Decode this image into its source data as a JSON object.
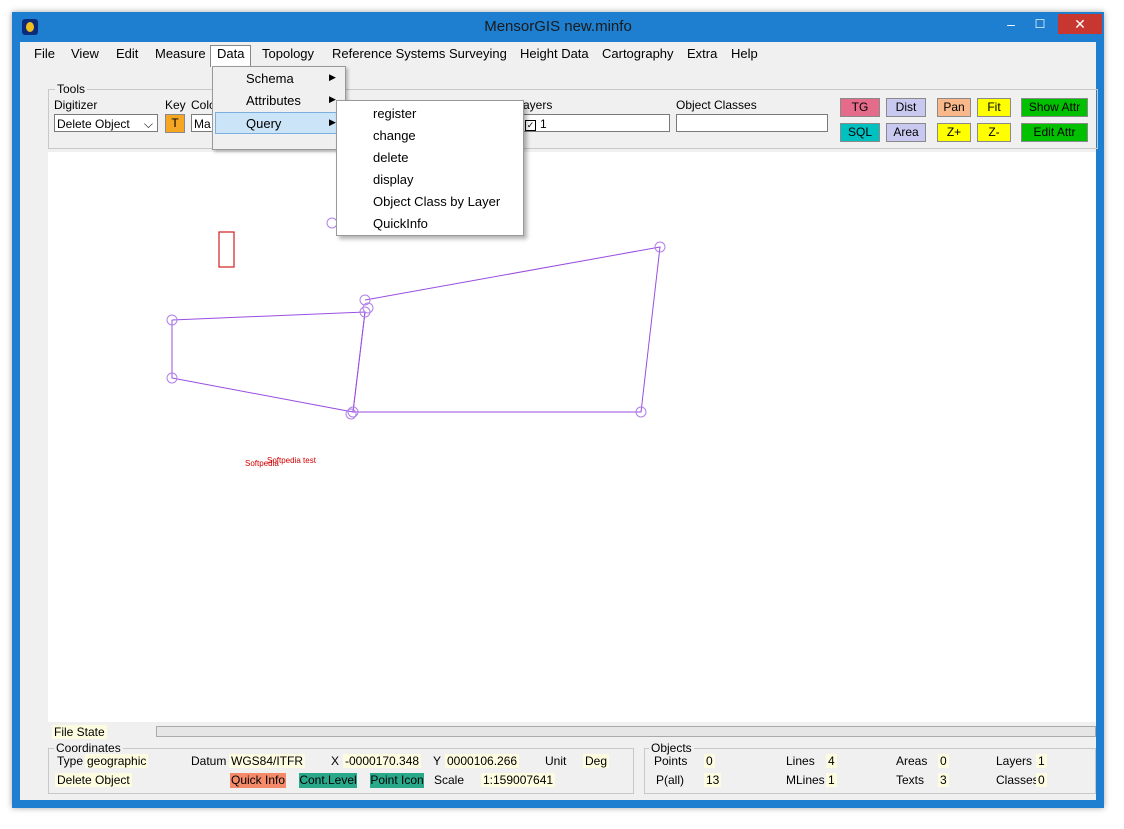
{
  "window": {
    "title": "MensorGIS new.minfo",
    "min": "–",
    "max": "☐",
    "close": "✕"
  },
  "menu": [
    "File",
    "View",
    "Edit",
    "Measure",
    "Data",
    "Topology",
    "Reference Systems",
    "Surveying",
    "Height Data",
    "Cartography",
    "Extra",
    "Help"
  ],
  "data_menu": [
    "Schema",
    "Attributes",
    "Query"
  ],
  "query_submenu": [
    "register",
    "change",
    "delete",
    "display",
    "Object Class by Layer",
    "QuickInfo"
  ],
  "tools": {
    "group": "Tools",
    "digitizer_label": "Digitizer",
    "digitizer_value": "Delete Object",
    "key_label": "Key",
    "key_value": "T",
    "color_label": "Colo",
    "color_value": "Ma",
    "layers_label": "ayers",
    "layers_value": "1",
    "object_classes_label": "Object Classes",
    "object_classes_value": ""
  },
  "buttons": {
    "tg": "TG",
    "dist": "Dist",
    "pan": "Pan",
    "fit": "Fit",
    "show_attr": "Show Attr",
    "sql": "SQL",
    "area": "Area",
    "zplus": "Z+",
    "zminus": "Z-",
    "edit_attr": "Edit Attr"
  },
  "canvas_labels": {
    "label1": "Softpedia",
    "label2": "Softpedia test"
  },
  "colors": {
    "tg": "#e56b8a",
    "dist": "#c8c8f0",
    "area": "#c8c8f0",
    "pan": "#f8b88a",
    "fit": "#ffff00",
    "zplus": "#ffff00",
    "zminus": "#ffff00",
    "show_attr": "#00c000",
    "edit_attr": "#00c000",
    "sql": "#00c0c0",
    "quick_info": "#f58a6a",
    "cont_level": "#2aa88a",
    "point_icon": "#2aa88a",
    "polygon": "#9a4de0"
  },
  "status": {
    "file_state": "File State",
    "coordinates": {
      "group": "Coordinates",
      "type_label": "Type",
      "type_value": "geographic",
      "mode_value": "Delete Object",
      "datum_label": "Datum",
      "datum_value": "WGS84/ITFR",
      "x_label": "X",
      "x_value": "-0000170.348",
      "y_label": "Y",
      "y_value": "0000106.266",
      "unit_label": "Unit",
      "unit_value": "Deg",
      "quick_info": "Quick Info",
      "cont_level": "Cont.Level",
      "point_icon": "Point Icon",
      "scale_label": "Scale",
      "scale_value": "1:159007641"
    },
    "objects": {
      "group": "Objects",
      "points_label": "Points",
      "points_value": "0",
      "lines_label": "Lines",
      "lines_value": "4",
      "areas_label": "Areas",
      "areas_value": "0",
      "layers_label": "Layers",
      "layers_value": "1",
      "pall_label": "P(all)",
      "pall_value": "13",
      "mlines_label": "MLines",
      "mlines_value": "1",
      "texts_label": "Texts",
      "texts_value": "3",
      "classes_label": "Classes",
      "classes_value": "0"
    }
  }
}
